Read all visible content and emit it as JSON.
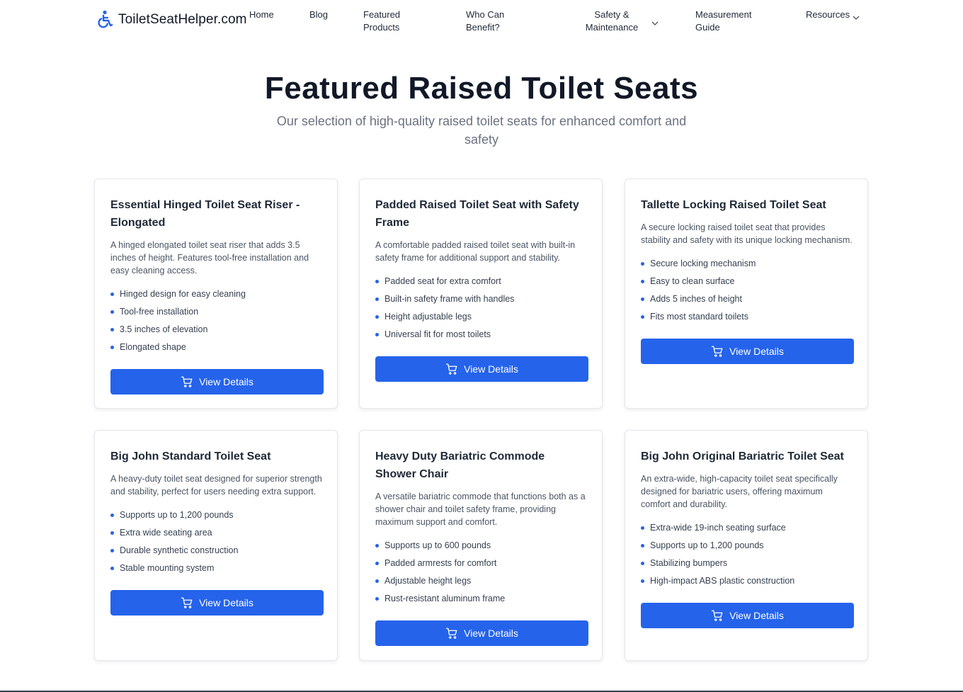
{
  "brand": {
    "name": "ToiletSeatHelper.com",
    "icon": "accessibility-icon",
    "color": "#2563eb"
  },
  "nav": {
    "home": "Home",
    "blog": "Blog",
    "featured_1": "Featured",
    "featured_2": "Products",
    "who_1": "Who Can",
    "who_2": "Benefit?",
    "safety_1": "Safety &",
    "safety_2": "Maintenance",
    "measure_1": "Measurement",
    "measure_2": "Guide",
    "resources": "Resources"
  },
  "hero": {
    "title": "Featured Raised Toilet Seats",
    "subtitle": "Our selection of high-quality raised toilet seats for enhanced comfort and safety"
  },
  "colors": {
    "accent": "#2563eb",
    "title": "#111827",
    "muted": "#6b7280"
  },
  "products": [
    {
      "title": "Essential Hinged Toilet Seat Riser - Elongated",
      "description": "A hinged elongated toilet seat riser that adds 3.5 inches of height. Features tool-free installation and easy cleaning access.",
      "features": [
        "Hinged design for easy cleaning",
        "Tool-free installation",
        "3.5 inches of elevation",
        "Elongated shape"
      ],
      "button": "View Details"
    },
    {
      "title": "Padded Raised Toilet Seat with Safety Frame",
      "description": "A comfortable padded raised toilet seat with built-in safety frame for additional support and stability.",
      "features": [
        "Padded seat for extra comfort",
        "Built-in safety frame with handles",
        "Height adjustable legs",
        "Universal fit for most toilets"
      ],
      "button": "View Details"
    },
    {
      "title": "Tallette Locking Raised Toilet Seat",
      "description": "A secure locking raised toilet seat that provides stability and safety with its unique locking mechanism.",
      "features": [
        "Secure locking mechanism",
        "Easy to clean surface",
        "Adds 5 inches of height",
        "Fits most standard toilets"
      ],
      "button": "View Details"
    },
    {
      "title": "Big John Standard Toilet Seat",
      "description": "A heavy-duty toilet seat designed for superior strength and stability, perfect for users needing extra support.",
      "features": [
        "Supports up to 1,200 pounds",
        "Extra wide seating area",
        "Durable synthetic construction",
        "Stable mounting system"
      ],
      "button": "View Details"
    },
    {
      "title": "Heavy Duty Bariatric Commode Shower Chair",
      "description": "A versatile bariatric commode that functions both as a shower chair and toilet safety frame, providing maximum support and comfort.",
      "features": [
        "Supports up to 600 pounds",
        "Padded armrests for comfort",
        "Adjustable height legs",
        "Rust-resistant aluminum frame"
      ],
      "button": "View Details"
    },
    {
      "title": "Big John Original Bariatric Toilet Seat",
      "description": "An extra-wide, high-capacity toilet seat specifically designed for bariatric users, offering maximum comfort and durability.",
      "features": [
        "Extra-wide 19-inch seating surface",
        "Supports up to 1,200 pounds",
        "Stabilizing bumpers",
        "High-impact ABS plastic construction"
      ],
      "button": "View Details"
    }
  ]
}
